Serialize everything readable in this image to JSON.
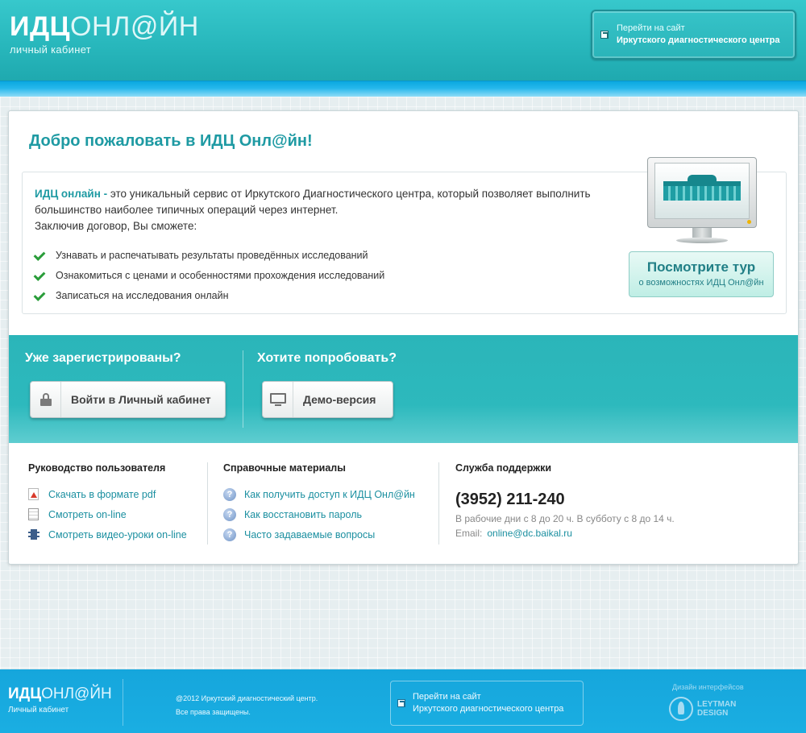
{
  "header": {
    "logo_primary": "ИДЦ",
    "logo_secondary": "ОНЛ@ЙН",
    "logo_subtitle": "личный кабинет",
    "site_link_line1": "Перейти на сайт",
    "site_link_line2": "Иркутского диагностического центра"
  },
  "main": {
    "welcome_title": "Добро пожаловать в ИДЦ Онл@йн!",
    "intro_bold": "ИДЦ онлайн -",
    "intro_text": " это уникальный сервис от Иркутского Диагностического центра, который позволяет выполнить большинство наиболее типичных операций через интернет.",
    "intro_contract": "Заключив договор, Вы сможете:",
    "features": [
      "Узнавать и распечатывать результаты проведённых исследований",
      "Ознакомиться с ценами и особенностями прохождения исследований",
      "Записаться на исследования онлайн"
    ],
    "tour_title": "Посмотрите тур",
    "tour_subtitle": "о возможностях ИДЦ Онл@йн"
  },
  "band": {
    "registered_heading": "Уже зарегистрированы?",
    "login_button": "Войти в Личный кабинет",
    "try_heading": "Хотите попробовать?",
    "demo_button": "Демо-версия"
  },
  "guide": {
    "title": "Руководство пользователя",
    "items": [
      "Скачать в формате pdf",
      "Смотреть on-line",
      "Смотреть видео-уроки on-line"
    ]
  },
  "reference": {
    "title": "Справочные материалы",
    "items": [
      "Как получить доступ к ИДЦ Онл@йн",
      "Как восстановить пароль",
      "Часто задаваемые вопросы"
    ]
  },
  "support": {
    "title": "Служба поддержки",
    "phone": "(3952) 211-240",
    "hours": "В рабочие дни с 8 до 20 ч. В субботу с 8 до 14 ч.",
    "email_label": "Email:",
    "email": "online@dc.baikal.ru"
  },
  "footer": {
    "logo_primary": "ИДЦ",
    "logo_secondary": "ОНЛ@ЙН",
    "logo_subtitle": "Личный кабинет",
    "copyright_line1": "@2012 Иркутский диагностический центр.",
    "copyright_line2": "Все права защищены.",
    "site_link_line1": "Перейти на сайт",
    "site_link_line2": "Иркутского диагностического центра",
    "design_label": "Дизайн интерфейсов",
    "designer_line1": "LEYTMAN",
    "designer_line2": "DESIGN"
  },
  "colors": {
    "accent_teal": "#2bb5b9",
    "link_blue": "#1b8fa0",
    "footer_blue": "#16a6dc",
    "check_green": "#2a9d3a"
  }
}
